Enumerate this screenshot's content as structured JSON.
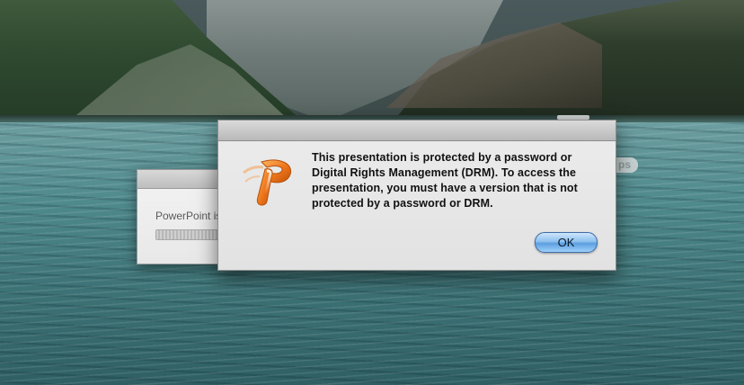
{
  "background_window": {
    "status_text": "PowerPoint is"
  },
  "peek_window": {
    "fragment_text": "ps"
  },
  "alert": {
    "message": "This presentation is protected by a password or Digital Rights Management (DRM).  To access the presentation, you must have a version that is not protected by a password or DRM.",
    "ok_label": "OK",
    "icon": "powerpoint-app-icon"
  },
  "colors": {
    "ok_button_accent": "#5c9ee0",
    "icon_orange": "#f07a1e",
    "lake_teal": "#4f8a8d"
  }
}
